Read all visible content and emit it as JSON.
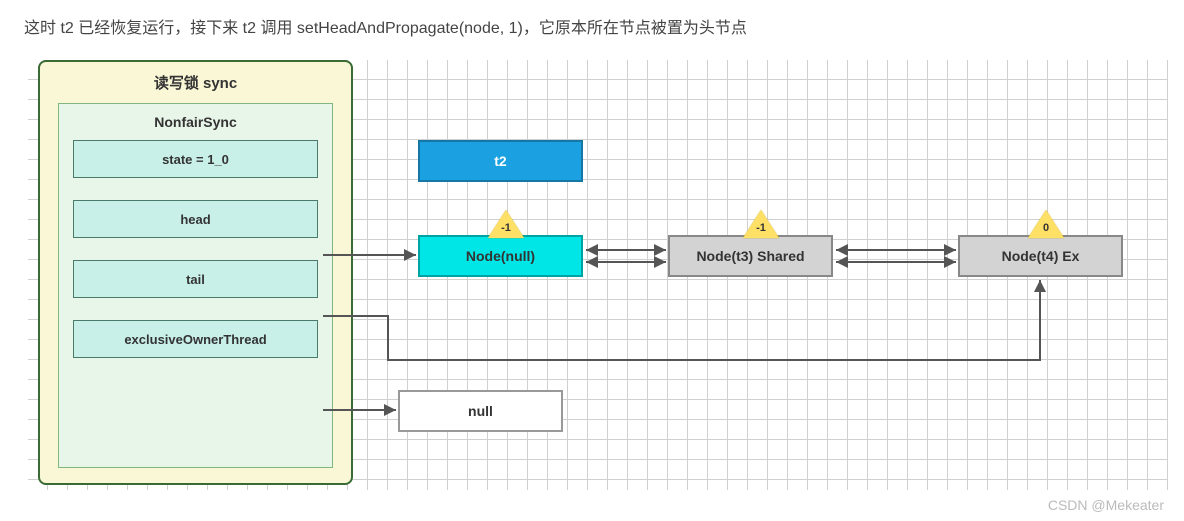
{
  "description": "这时 t2 已经恢复运行，接下来 t2 调用 setHeadAndPropagate(node, 1)，它原本所在节点被置为头节点",
  "sync": {
    "title": "读写锁 sync",
    "nonfair_title": "NonfairSync",
    "fields": {
      "state": "state = 1_0",
      "head": "head",
      "tail": "tail",
      "exclusiveOwnerThread": "exclusiveOwnerThread"
    }
  },
  "thread_box": "t2",
  "nodes": {
    "n1": {
      "label": "Node(null)",
      "triangle": "-1"
    },
    "n2": {
      "label": "Node(t3) Shared",
      "triangle": "-1"
    },
    "n3": {
      "label": "Node(t4) Ex",
      "triangle": "0"
    }
  },
  "null_box": "null",
  "watermark": "CSDN @Mekeater"
}
